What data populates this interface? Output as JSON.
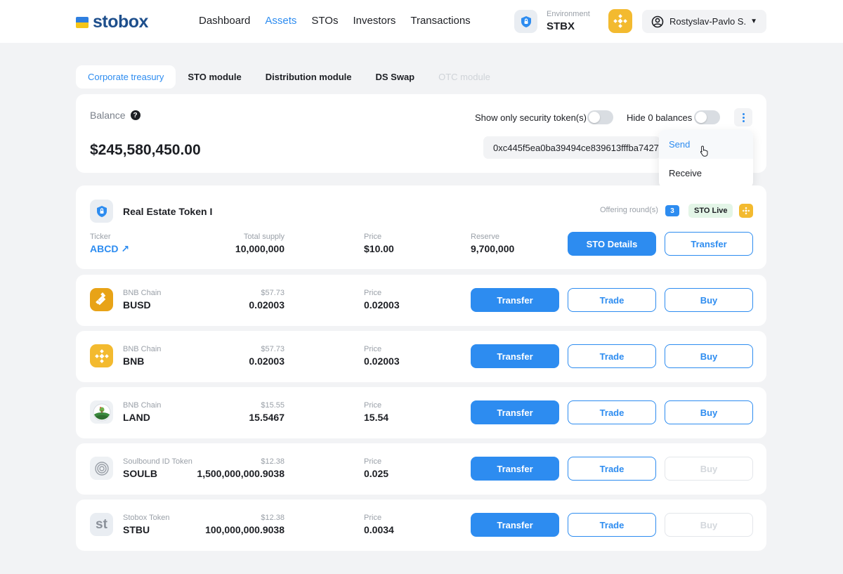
{
  "header": {
    "logo_text": "stobox",
    "nav": [
      "Dashboard",
      "Assets",
      "STOs",
      "Investors",
      "Transactions"
    ],
    "active_nav": "Assets",
    "environment_label": "Environment",
    "environment_value": "STBX",
    "user_name": "Rostyslav-Pavlo S."
  },
  "tabs": [
    {
      "label": "Corporate treasury",
      "state": "active"
    },
    {
      "label": "STO module",
      "state": "normal"
    },
    {
      "label": "Distribution module",
      "state": "normal"
    },
    {
      "label": "DS Swap",
      "state": "normal"
    },
    {
      "label": "OTC module",
      "state": "disabled"
    }
  ],
  "balance": {
    "label": "Balance",
    "help": "?",
    "value": "$245,580,450.00",
    "toggle_security_label": "Show only security token(s)",
    "toggle_hide_zero_label": "Hide 0 balances",
    "address": "0xc445f5ea0ba39494ce839613fffba7427"
  },
  "menu": {
    "send": "Send",
    "receive": "Receive"
  },
  "real_estate_token": {
    "name": "Real Estate Token I",
    "offering_label": "Offering round(s)",
    "offering_count": "3",
    "status": "STO Live",
    "ticker_label": "Ticker",
    "ticker_value": "ABCD",
    "supply_label": "Total supply",
    "supply_value": "10,000,000",
    "price_label": "Price",
    "price_value": "$10.00",
    "reserve_label": "Reserve",
    "reserve_value": "9,700,000",
    "details_button": "STO Details",
    "transfer_button": "Transfer"
  },
  "tokens": [
    {
      "chain": "BNB Chain",
      "symbol": "BUSD",
      "usd": "$57.73",
      "amount": "0.02003",
      "price_label": "Price",
      "price": "0.02003",
      "buy_enabled": true,
      "icon": "busd-icon"
    },
    {
      "chain": "BNB Chain",
      "symbol": "BNB",
      "usd": "$57.73",
      "amount": "0.02003",
      "price_label": "Price",
      "price": "0.02003",
      "buy_enabled": true,
      "icon": "bnb-icon"
    },
    {
      "chain": "BNB Chain",
      "symbol": "LAND",
      "usd": "$15.55",
      "amount": "15.5467",
      "price_label": "Price",
      "price": "15.54",
      "buy_enabled": true,
      "icon": "land-icon"
    },
    {
      "chain": "Soulbound ID Token",
      "symbol": "SOULB",
      "usd": "$12.38",
      "amount": "1,500,000,000.9038",
      "price_label": "Price",
      "price": "0.025",
      "buy_enabled": false,
      "icon": "soulbound-icon"
    },
    {
      "chain": "Stobox Token",
      "symbol": "STBU",
      "usd": "$12.38",
      "amount": "100,000,000.9038",
      "price_label": "Price",
      "price": "0.0034",
      "buy_enabled": false,
      "icon": "stobox-token-icon",
      "icon_text": "st"
    }
  ],
  "token_buttons": {
    "transfer": "Transfer",
    "trade": "Trade",
    "buy": "Buy"
  },
  "colors": {
    "accent": "#2d8cf0",
    "bnb": "#f3ba2f",
    "background": "#f2f3f5"
  }
}
